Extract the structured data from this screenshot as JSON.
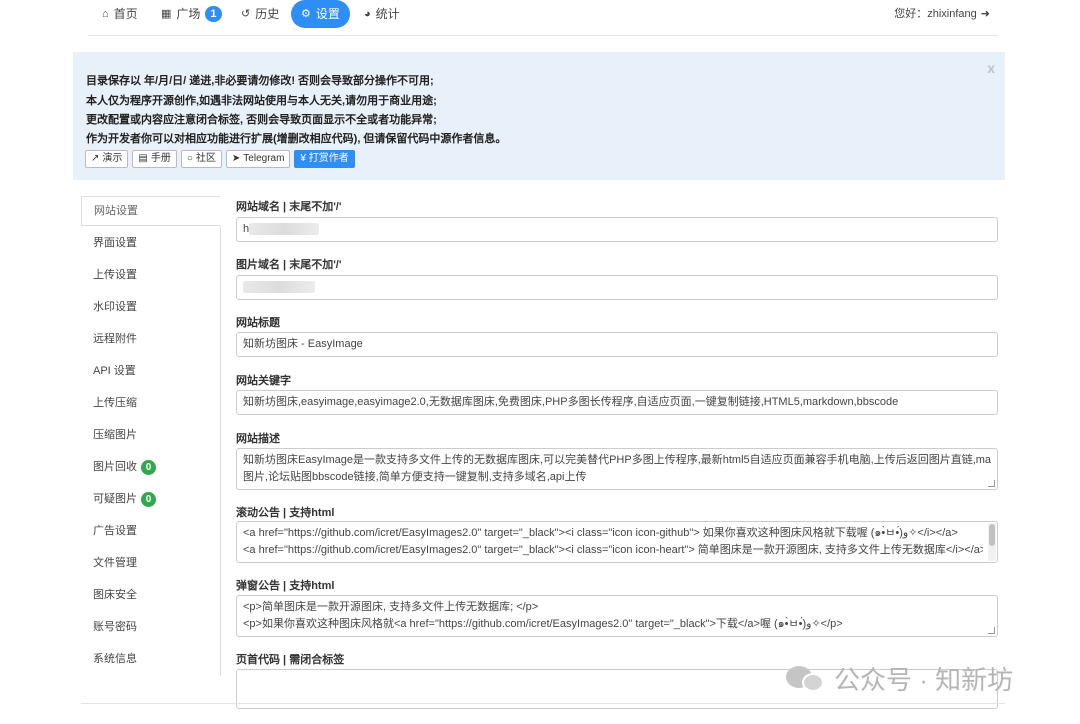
{
  "nav": {
    "home": "首页",
    "square": "广场",
    "square_badge": "1",
    "history": "历史",
    "settings": "设置",
    "stats": "统计",
    "greeting": "您好：zhixinfang"
  },
  "notice": {
    "lines": [
      "目录保存以 年/月/日/ 递进,非必要请勿修改! 否则会导致部分操作不可用;",
      "本人仅为程序开源创作,如遇非法网站使用与本人无关,请勿用于商业用途;",
      "更改配置或内容应注意闭合标签, 否则会导致页面显示不全或者功能异常;",
      "作为开发者你可以对相应功能进行扩展(增删改相应代码), 但请保留代码中源作者信息。"
    ],
    "close": "x",
    "buttons": {
      "demo": "演示",
      "manual": "手册",
      "community": "社区",
      "telegram": "Telegram",
      "donate": "¥ 打赏作者"
    }
  },
  "sidebar": {
    "items": [
      "网站设置",
      "界面设置",
      "上传设置",
      "水印设置",
      "远程附件",
      "API 设置",
      "上传压缩",
      "压缩图片",
      "图片回收",
      "可疑图片",
      "广告设置",
      "文件管理",
      "图床安全",
      "账号密码",
      "系统信息"
    ],
    "recycle_badge": "0",
    "suspicious_badge": "0"
  },
  "form": {
    "site_domain": {
      "label": "网站域名 | 末尾不加'/'",
      "value": "h"
    },
    "image_domain": {
      "label": "图片域名 | 末尾不加'/'",
      "value": ""
    },
    "site_title": {
      "label": "网站标题",
      "value": "知新坊图床 - EasyImage"
    },
    "keywords": {
      "label": "网站关键字",
      "value": "知新坊图床,easyimage,easyimage2.0,无数据库图床,免费图床,PHP多图长传程序,自适应页面,一键复制链接,HTML5,markdown,bbscode"
    },
    "description": {
      "label": "网站描述",
      "line1": "知新坊图床EasyImage是一款支持多文件上传的无数据库图床,可以完美替代PHP多图上传程序,最新html5自适应页面兼容手机电脑,上传后返回图片直链,markdown",
      "line2": "图片,论坛贴图bbscode链接,简单方便支持一键复制,支持多域名,api上传"
    },
    "scroll_notice": {
      "label": "滚动公告 | 支持html",
      "line1": "<a href=\"https://github.com/icret/EasyImages2.0\" target=\"_black\"><i class=\"icon icon-github\"> 如果你喜欢这种图床风格就下载喔 (๑•̀ㅂ•́)و✧</i></a>",
      "line2": "<a href=\"https://github.com/icret/EasyImages2.0\" target=\"_black\"><i class=\"icon icon-heart\"> 简单图床是一款开源图床, 支持多文件上传无数据库</i></a>"
    },
    "popup_notice": {
      "label": "弹窗公告 | 支持html",
      "line1": "<p>简单图床是一款开源图床, 支持多文件上传无数据库; </p>",
      "line2": "<p>如果你喜欢这种图床风格就<a href=\"https://github.com/icret/EasyImages2.0\" target=\"_black\">下载</a>喔 (๑•̀ㅂ•́)و✧</p>"
    },
    "header_code": {
      "label": "页首代码 | 需闭合标签",
      "value": ""
    }
  },
  "watermark": "公众号 · 知新坊"
}
